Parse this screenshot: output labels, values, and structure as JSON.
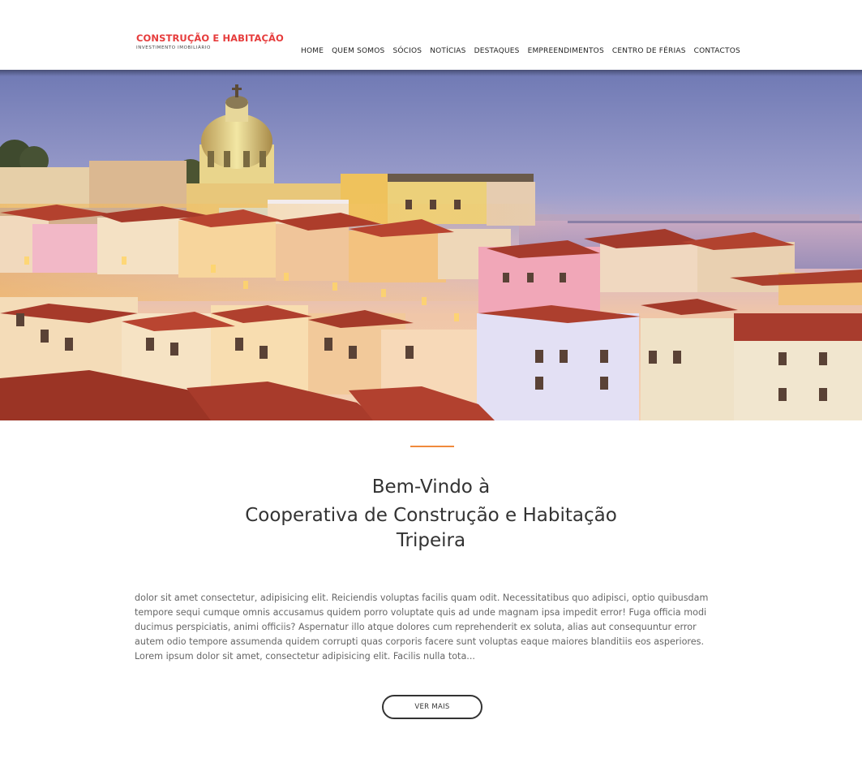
{
  "brand": {
    "title": "CONSTRUÇÃO E HABITAÇÃO",
    "subtitle": "INVESTIMENTO IMOBILIÁRIO",
    "accent_color": "#e63c3c"
  },
  "nav": {
    "items": [
      {
        "label": "HOME"
      },
      {
        "label": "QUEM SOMOS"
      },
      {
        "label": "SÓCIOS"
      },
      {
        "label": "NOTÍCIAS"
      },
      {
        "label": "DESTAQUES"
      },
      {
        "label": "EMPREENDIMENTOS"
      },
      {
        "label": "CENTRO DE FÉRIAS"
      },
      {
        "label": "CONTACTOS"
      }
    ]
  },
  "hero": {
    "image": "lisbon-cityscape-at-dusk",
    "slides_total": 3,
    "active_slide": 1,
    "active_color": "#f08a3c"
  },
  "welcome": {
    "line1": "Bem-Vindo à",
    "line2": "Cooperativa de Construção e Habitação",
    "line3": "Tripeira",
    "divider_color": "#f08a3c"
  },
  "intro": {
    "text": "dolor sit amet consectetur, adipisicing elit. Reiciendis voluptas facilis quam odit. Necessitatibus quo adipisci, optio quibusdam tempore sequi cumque omnis accusamus quidem porro voluptate quis ad unde magnam ipsa impedit error! Fuga officia modi ducimus perspiciatis, animi officiis? Aspernatur illo atque dolores cum reprehenderit ex soluta, alias aut consequuntur error autem odio tempore assumenda quidem corrupti quas corporis facere sunt voluptas eaque maiores blanditiis eos asperiores. Lorem ipsum dolor sit amet, consectetur adipisicing elit. Facilis nulla tota..."
  },
  "cta": {
    "label": "VER MAIS"
  }
}
